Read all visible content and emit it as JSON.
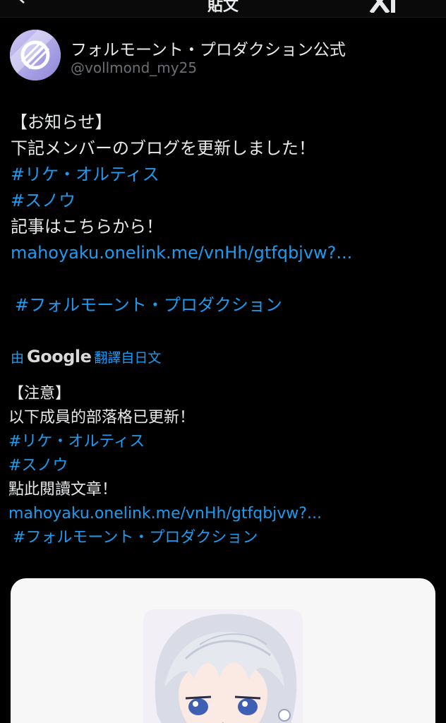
{
  "topbar": {
    "title": "貼文"
  },
  "author": {
    "display_name": "フォルモーント・プロダクション公式",
    "handle": "@vollmond_my25"
  },
  "post": {
    "lines": [
      "【お知らせ】",
      "下記メンバーのブログを更新しました！"
    ],
    "hashtag_1": "#リケ・オルティス",
    "hashtag_2": "#スノウ",
    "read_here": "記事はこちらから！",
    "link": "mahoyaku.onelink.me/vnHh/gtfqbjvw?...",
    "hashtag_3": "#フォルモーント・プロダクション"
  },
  "translation_credit": {
    "prefix": "由",
    "google": "Google",
    "suffix": "翻譯自日文"
  },
  "translation": {
    "line_1": "【注意】",
    "line_2": "以下成員的部落格已更新！",
    "hashtag_1": "#リケ・オルティス",
    "hashtag_2": "#スノウ",
    "read_here": "點此閱讀文章！",
    "link": "mahoyaku.onelink.me/vnHh/gtfqbjvw?...",
    "hashtag_3": "#フォルモーント・プロダクション"
  },
  "colors": {
    "background": "#000000",
    "text": "#e7e9ea",
    "link": "#1d9bf0",
    "handle": "#6b6f74",
    "card": "#f7f7f8"
  },
  "icons": {
    "back": "back-arrow-icon",
    "brand": "x-logo-icon",
    "avatar": "moon-logo-avatar"
  }
}
